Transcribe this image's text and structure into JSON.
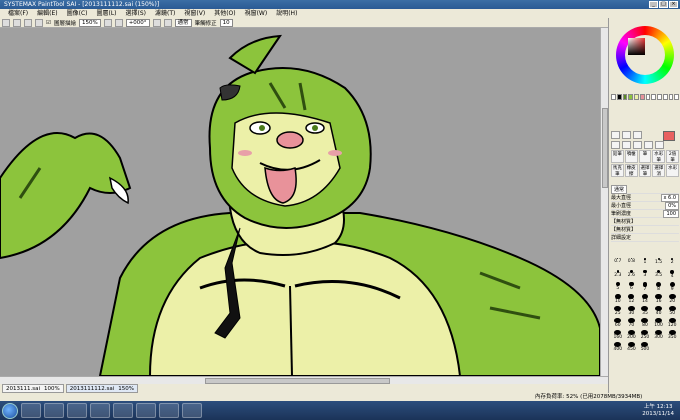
{
  "window": {
    "title": "SYSTEMAX PaintTool SAI - [2013111112.sai (150%)]"
  },
  "menu": {
    "items": [
      "檔案(F)",
      "編輯(E)",
      "圖像(C)",
      "圖層(L)",
      "選擇(S)",
      "濾鏡(T)",
      "視窗(V)",
      "其他(O)",
      "視窗(W)",
      "說明(H)"
    ]
  },
  "toolbar": {
    "stabilizer_checkbox_label": "圖層描繪",
    "zoom_value": "150%",
    "angle_value": "+000°",
    "mode_value": "通常",
    "stabilizer_label": "筆觸修正",
    "stabilizer_value": "10"
  },
  "panel": {
    "mode_value": "通常",
    "props": [
      {
        "label": "最大直徑",
        "value": "x 6.0"
      },
      {
        "label": "最小直徑",
        "value": "0%"
      },
      {
        "label": "筆刷濃度",
        "value": "100"
      },
      {
        "label": "【無材質】",
        "value": ""
      },
      {
        "label": "【無材質】",
        "value": ""
      },
      {
        "label": "詳細設定",
        "value": ""
      }
    ],
    "brushes": [
      "鉛筆",
      "噴槍",
      "筆",
      "水彩筆",
      "2值筆",
      "馬克筆",
      "橡皮擦",
      "選擇筆",
      "選擇消",
      "水彩",
      "水彩筆",
      "圓筆",
      "水彩筆",
      "筆刷",
      "漸層"
    ],
    "dot_labels": [
      "0.7",
      "0.8",
      "1",
      "1.5",
      "2",
      "2.3",
      "2.6",
      "3",
      "3.5",
      "4",
      "5",
      "6",
      "7",
      "8",
      "9",
      "10",
      "12",
      "14",
      "16",
      "20",
      "25",
      "30",
      "35",
      "40",
      "50",
      "60",
      "70",
      "80",
      "100",
      "120",
      "160",
      "200",
      "250",
      "300",
      "350",
      "400",
      "450",
      "500"
    ]
  },
  "colors": {
    "canvas_bg": "#a0a0a0",
    "skin": "#ecf0a8",
    "green": "#8cc43c",
    "dark_green": "#5a8a22",
    "tongue": "#e8929a",
    "current_color": "#e86060"
  },
  "file_tabs": [
    {
      "name": "2013111.sai",
      "zoom": "100%"
    },
    {
      "name": "2013111112.sai",
      "zoom": "150%"
    }
  ],
  "status": {
    "memory_text": "內存負荷率: 52% (已用2078MB/3934MB)"
  },
  "clock": {
    "time": "上午 12:13",
    "date": "2013/11/14"
  }
}
